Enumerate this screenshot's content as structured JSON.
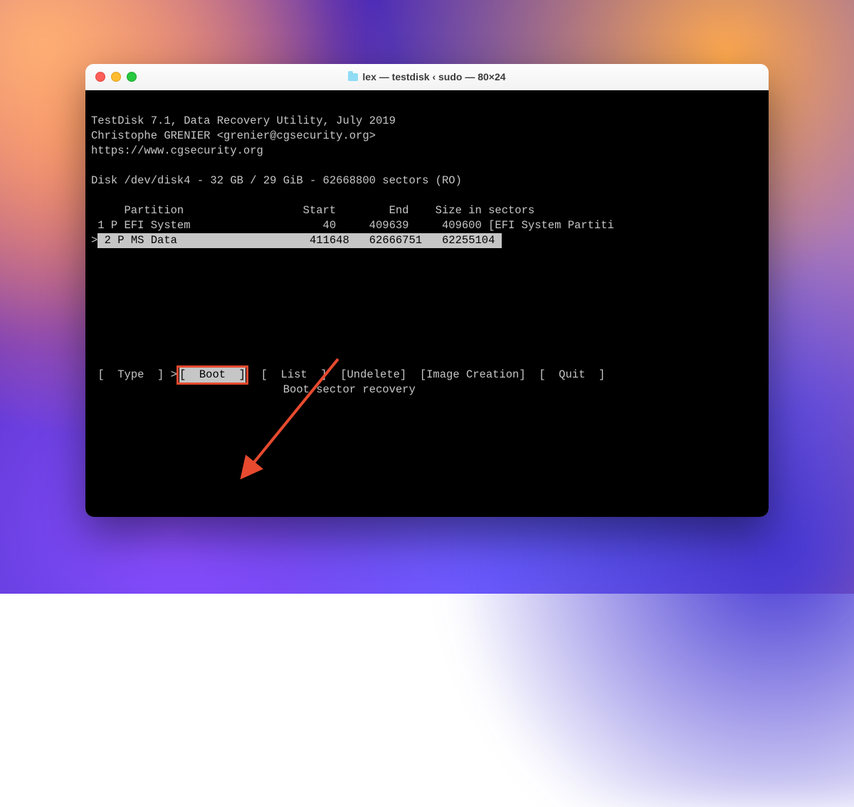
{
  "window": {
    "title": "lex — testdisk ‹ sudo — 80×24"
  },
  "header": {
    "line1": "TestDisk 7.1, Data Recovery Utility, July 2019",
    "line2": "Christophe GRENIER <grenier@cgsecurity.org>",
    "line3": "https://www.cgsecurity.org"
  },
  "disk_line": "Disk /dev/disk4 - 32 GB / 29 GiB - 62668800 sectors (RO)",
  "table": {
    "header": "     Partition                  Start        End    Size in sectors",
    "row1": " 1 P EFI System                    40     409639     409600 [EFI System Partiti",
    "row2": " 2 P MS Data                    411648   62666751   62255104 "
  },
  "row2_prefix": ">",
  "menu": {
    "type": "[  Type  ]",
    "sel_prefix": ">",
    "boot": "[  Boot  ]",
    "list": "[  List  ]",
    "undelete": "[Undelete]",
    "image": "[Image Creation]",
    "quit": "[  Quit  ]"
  },
  "footer": "                             Boot sector recovery"
}
